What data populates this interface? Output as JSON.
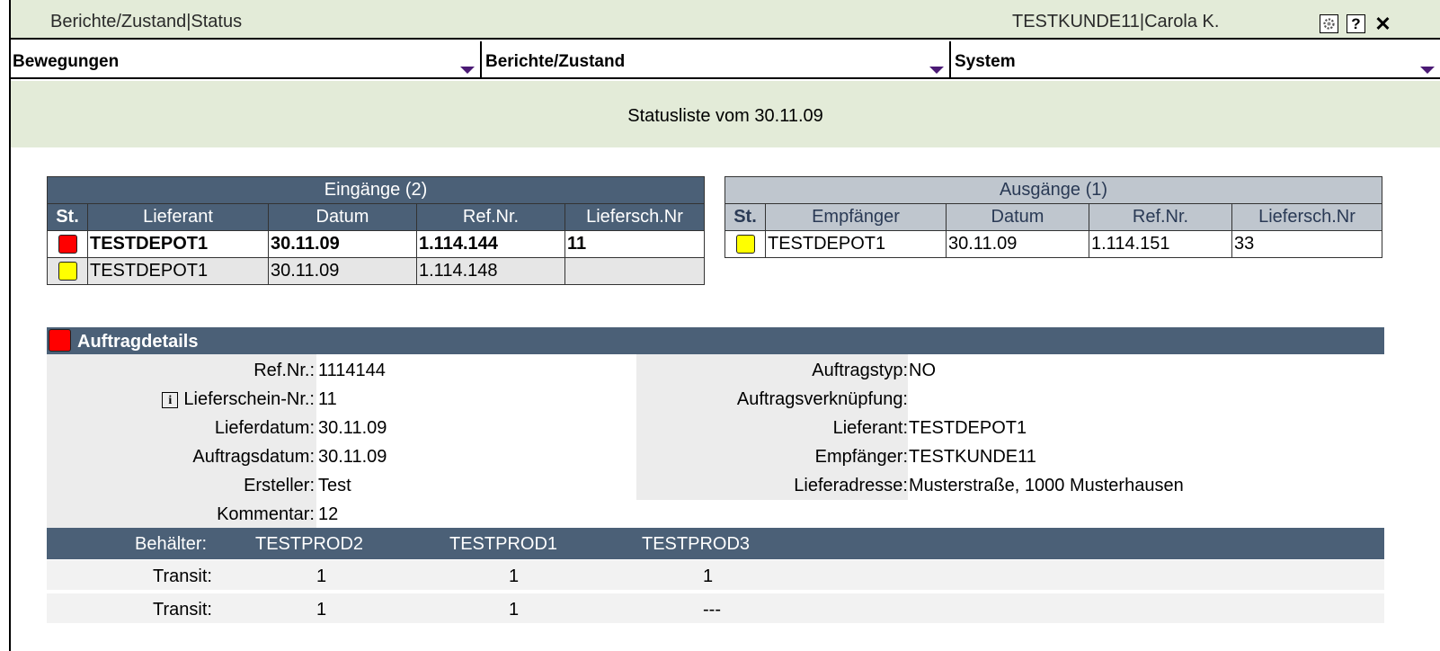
{
  "window": {
    "breadcrumb": "Berichte/Zustand|Status",
    "user": "TESTKUNDE11|Carola K.",
    "gear_icon": "gear-icon",
    "help_label": "?",
    "close_label": "✕"
  },
  "menu": {
    "items": [
      {
        "label": "Bewegungen"
      },
      {
        "label": "Berichte/Zustand"
      },
      {
        "label": "System"
      }
    ]
  },
  "banner": "Statusliste vom 30.11.09",
  "eingaenge": {
    "caption": "Eingänge (2)",
    "columns": [
      "St.",
      "Lieferant",
      "Datum",
      "Ref.Nr.",
      "Liefersch.Nr"
    ],
    "rows": [
      {
        "status": "red",
        "lieferant": "TESTDEPOT1",
        "datum": "30.11.09",
        "ref": "1.114.144",
        "liefersch": "11"
      },
      {
        "status": "yellow",
        "lieferant": "TESTDEPOT1",
        "datum": "30.11.09",
        "ref": "1.114.148",
        "liefersch": ""
      }
    ]
  },
  "ausgaenge": {
    "caption": "Ausgänge (1)",
    "columns": [
      "St.",
      "Empfänger",
      "Datum",
      "Ref.Nr.",
      "Liefersch.Nr"
    ],
    "rows": [
      {
        "status": "yellow",
        "empfaenger": "TESTDEPOT1",
        "datum": "30.11.09",
        "ref": "1.114.151",
        "liefersch": "33"
      }
    ]
  },
  "details": {
    "title": "Auftragdetails",
    "left": [
      {
        "label": "Ref.Nr.:",
        "value": "1114144"
      },
      {
        "label": "Lieferschein-Nr.:",
        "value": "11"
      },
      {
        "label": "Lieferdatum:",
        "value": "30.11.09"
      },
      {
        "label": "Auftragsdatum:",
        "value": "30.11.09"
      },
      {
        "label": "Ersteller:",
        "value": "Test"
      },
      {
        "label": "Kommentar:",
        "value": "12"
      }
    ],
    "right": [
      {
        "label": "Auftragstyp:",
        "value": "NO"
      },
      {
        "label": "Auftragsverknüpfung:",
        "value": ""
      },
      {
        "label": "Lieferant:",
        "value": "TESTDEPOT1"
      },
      {
        "label": "Empfänger:",
        "value": "TESTKUNDE11"
      },
      {
        "label": "Lieferadresse:",
        "value": "Musterstraße, 1000 Musterhausen"
      }
    ],
    "info_icon_label": "i"
  },
  "containers": {
    "label": "Behälter:",
    "products": [
      "TESTPROD2",
      "TESTPROD1",
      "TESTPROD3"
    ],
    "rows": [
      {
        "label": "Transit:",
        "values": [
          "1",
          "1",
          "1"
        ]
      },
      {
        "label": "Transit:",
        "values": [
          "1",
          "1",
          "---"
        ]
      }
    ]
  },
  "colors": {
    "header_blue": "#4b6077",
    "title_green": "#e3ebd8",
    "status_red": "#ff0000",
    "status_yellow": "#ffff00"
  }
}
